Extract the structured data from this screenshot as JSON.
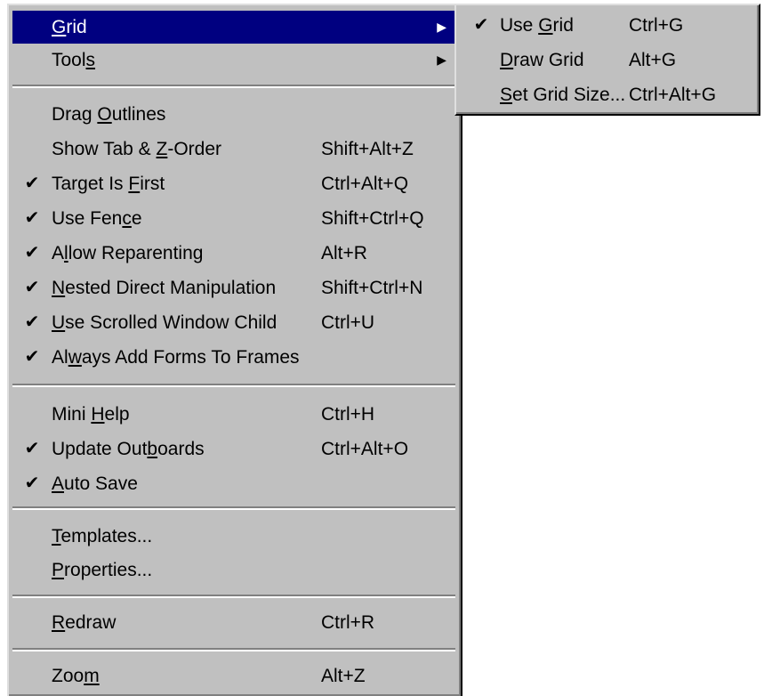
{
  "main_menu": {
    "grid": {
      "label": "Grid",
      "accel": "G",
      "arrow": "▶"
    },
    "tools": {
      "label": "Tools",
      "accel": "s",
      "arrow": "▶"
    },
    "drag_outlines": {
      "label": "Drag Outlines",
      "accel": "O",
      "check": "",
      "shortcut": ""
    },
    "show_tab": {
      "label": "Show Tab & Z-Order",
      "accel": "Z",
      "check": "",
      "shortcut": "Shift+Alt+Z"
    },
    "target_first": {
      "label": "Target Is First",
      "accel": "F",
      "check": "✔",
      "shortcut": "Ctrl+Alt+Q"
    },
    "use_fence": {
      "label": "Use Fence",
      "accel": "c",
      "check": "✔",
      "shortcut": "Shift+Ctrl+Q"
    },
    "allow_reparent": {
      "label": "Allow Reparenting",
      "accel": "l",
      "check": "✔",
      "shortcut": "Alt+R"
    },
    "nested_direct": {
      "label": "Nested Direct Manipulation",
      "accel": "N",
      "check": "✔",
      "shortcut": "Shift+Ctrl+N"
    },
    "scrolled_child": {
      "label": "Use Scrolled Window Child",
      "accel": "U",
      "check": "✔",
      "shortcut": "Ctrl+U"
    },
    "always_add": {
      "label": "Always Add Forms To Frames",
      "accel": "w",
      "check": "✔",
      "shortcut": ""
    },
    "mini_help": {
      "label": "Mini Help",
      "accel": "H",
      "check": "",
      "shortcut": "Ctrl+H"
    },
    "update_out": {
      "label": "Update Outboards",
      "accel": "b",
      "check": "✔",
      "shortcut": "Ctrl+Alt+O"
    },
    "auto_save": {
      "label": "Auto Save",
      "accel": "A",
      "check": "✔",
      "shortcut": ""
    },
    "templates": {
      "label": "Templates...",
      "accel": "T",
      "shortcut": ""
    },
    "properties": {
      "label": "Properties...",
      "accel": "P",
      "shortcut": ""
    },
    "redraw": {
      "label": "Redraw",
      "accel": "R",
      "shortcut": "Ctrl+R"
    },
    "zoom": {
      "label": "Zoom",
      "accel": "m",
      "shortcut": "Alt+Z"
    }
  },
  "grid_submenu": {
    "use_grid": {
      "label": "Use Grid",
      "accel": "G",
      "check": "✔",
      "shortcut": "Ctrl+G"
    },
    "draw_grid": {
      "label": "Draw Grid",
      "accel": "D",
      "check": "",
      "shortcut": "Alt+G"
    },
    "set_size": {
      "label": "Set Grid Size...",
      "accel": "S",
      "check": "",
      "shortcut": "Ctrl+Alt+G"
    }
  },
  "colors": {
    "menu_bg": "#c0c0c0",
    "highlight": "#000080",
    "highlight_text": "#ffffff"
  }
}
